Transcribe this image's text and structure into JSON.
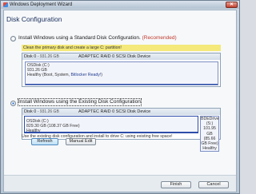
{
  "window": {
    "title": "Windows Deployment Wizard",
    "close_glyph": "✕"
  },
  "page": {
    "heading": "Disk Configuration"
  },
  "option_standard": {
    "label": "Install Windows using a Standard Disk Configuration.",
    "recommended": "(Recomended)",
    "banner": "Clean the primary disk and create a large C: partition!"
  },
  "standard_disk": {
    "name": "Disk 0",
    "size": "- 931.26 GB",
    "adapter": "ADAPTEC RAID 0 SCSI Disk Device",
    "partition": {
      "label": "OSDisk (C:)",
      "size": "931.26 GB",
      "status_prefix": "Healthy (Boot, System, ",
      "status_highlight": "Bitlocker Ready!",
      "status_suffix": ")"
    }
  },
  "option_existing": {
    "label": "Install Windows using the Existing Disk Configuration"
  },
  "existing_disk": {
    "name": "Disk 0",
    "size": "- 931.26 GB",
    "adapter": "ADAPTEC RAID 0 SCSI Disk Device",
    "partition_main": {
      "label": "OSDisk (C:)",
      "size": "829.30 GB (108.37 GB Free)",
      "status": "Healthy"
    },
    "partition_bde": {
      "line1": "BDEDrive",
      "line2": "(S:)",
      "line3": "101.95",
      "line4": "GB (85.66",
      "line5": "GB Free)",
      "line6": "Healthy"
    }
  },
  "hint": "Use the existing disk configuration and install to drive C: using existing free space!",
  "buttons": {
    "refresh": "Refresh",
    "manual_edit": "Manual Edit",
    "finish": "Finish",
    "cancel": "Cancel"
  },
  "colors": {
    "banner": "#f4e97a",
    "recommended": "#c0392b",
    "heading": "#1b2f5c"
  }
}
